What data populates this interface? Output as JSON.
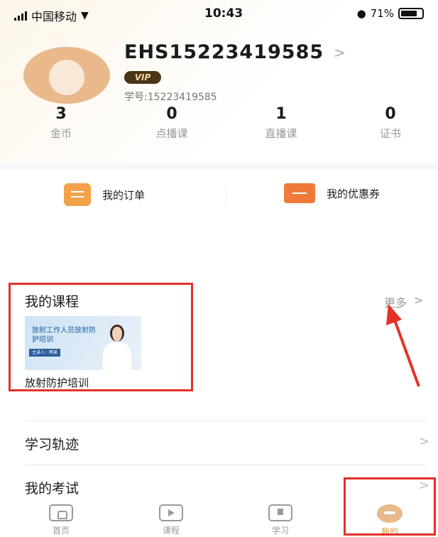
{
  "status_bar": {
    "carrier": "中国移动",
    "time": "10:43",
    "battery": "71%"
  },
  "profile": {
    "username": "EHS15223419585",
    "vip": "VIP",
    "student_id": "学号:15223419585"
  },
  "stats": [
    {
      "value": "3",
      "label": "金币"
    },
    {
      "value": "0",
      "label": "点播课"
    },
    {
      "value": "1",
      "label": "直播课"
    },
    {
      "value": "0",
      "label": "证书"
    }
  ],
  "quick_actions": {
    "orders": "我的订单",
    "coupons": "我的优惠券"
  },
  "my_courses": {
    "title": "我的课程",
    "more": "更多",
    "more_chevron": ">",
    "card_title": "放射工作人员放射防护培训",
    "card_tag": "主讲人：韩某",
    "course_name": "放射防护培训"
  },
  "menu": [
    {
      "label": "学习轨迹",
      "chevron": ">"
    },
    {
      "label": "我的考试",
      "chevron": ">"
    }
  ],
  "bottom_nav": [
    {
      "label": "首页",
      "icon": "home-icon"
    },
    {
      "label": "课程",
      "icon": "play-course-icon"
    },
    {
      "label": "学习",
      "icon": "study-icon"
    },
    {
      "label": "我的",
      "icon": "mine-avatar-icon"
    }
  ],
  "colors": {
    "annotation_red": "#e5302a",
    "vip_dark": "#4a3517",
    "orange_accent": "#f3a24a",
    "active_tab": "#e0922f"
  }
}
